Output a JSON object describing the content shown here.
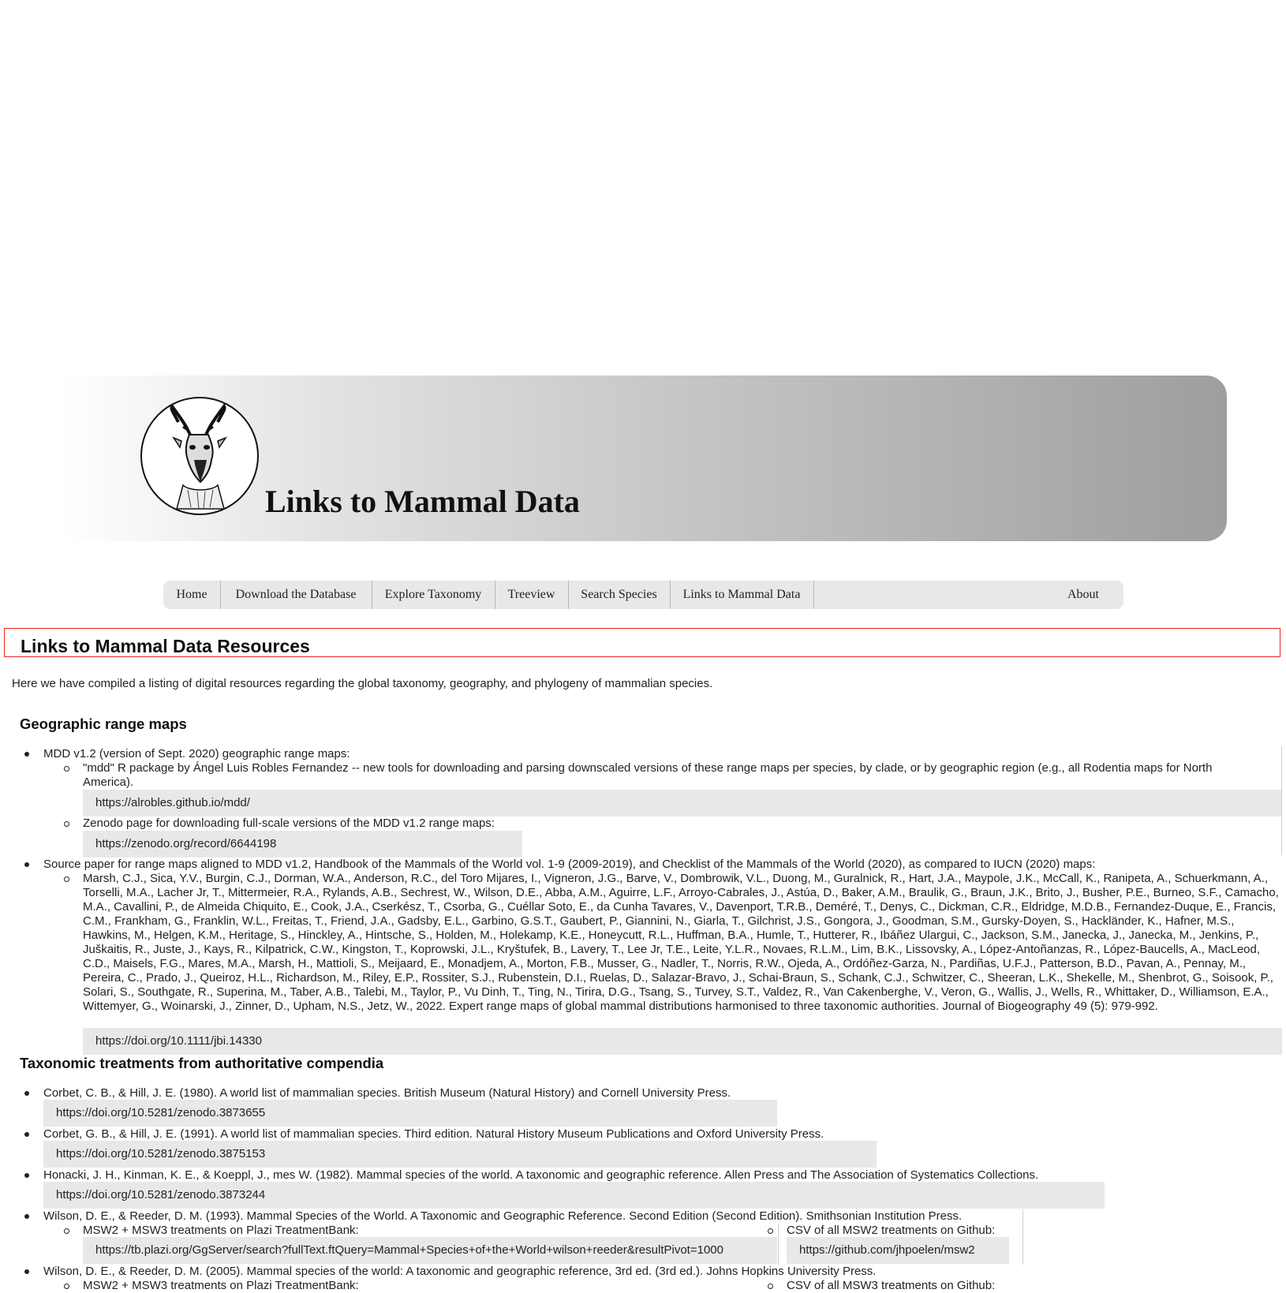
{
  "header": {
    "site_title": "Links to Mammal Data"
  },
  "nav": {
    "items": [
      {
        "label": "Home"
      },
      {
        "label": "Download the Database"
      },
      {
        "label": "Explore Taxonomy"
      },
      {
        "label": "Treeview"
      },
      {
        "label": "Search Species"
      },
      {
        "label": "Links to Mammal Data"
      }
    ],
    "about": "About"
  },
  "page": {
    "title": "Links to Mammal Data Resources",
    "intro": "Here we have compiled a listing of digital resources regarding the global taxonomy, geography, and phylogeny of mammalian species."
  },
  "geographic": {
    "heading": "Geographic range maps",
    "item1": {
      "text": "MDD v1.2 (version of Sept. 2020) geographic range maps:",
      "sub1_text": "\"mdd\" R package by Ángel Luis Robles Fernandez -- new tools for downloading and parsing downscaled versions of these range maps per species, by clade, or by geographic region (e.g., all Rodentia maps for North America).",
      "sub1_link": "https://alrobles.github.io/mdd/",
      "sub2_text": "Zenodo page for downloading full-scale versions of the MDD v1.2 range maps:",
      "sub2_link": "https://zenodo.org/record/6644198"
    },
    "item2": {
      "text": "Source paper for range maps aligned to MDD v1.2, Handbook of the Mammals of the World vol. 1-9 (2009-2019), and Checklist of the Mammals of the World (2020), as compared to IUCN (2020) maps:",
      "citation": "Marsh, C.J., Sica, Y.V., Burgin, C.J., Dorman, W.A., Anderson, R.C., del Toro Mijares, I., Vigneron, J.G., Barve, V., Dombrowik, V.L., Duong, M., Guralnick, R., Hart, J.A., Maypole, J.K., McCall, K., Ranipeta, A., Schuerkmann, A., Torselli, M.A., Lacher Jr, T., Mittermeier, R.A., Rylands, A.B., Sechrest, W., Wilson, D.E., Abba, A.M., Aguirre, L.F., Arroyo-Cabrales, J., Astúa, D., Baker, A.M., Braulik, G., Braun, J.K., Brito, J., Busher, P.E., Burneo, S.F., Camacho, M.A., Cavallini, P., de Almeida Chiquito, E., Cook, J.A., Cserkész, T., Csorba, G., Cuéllar Soto, E., da Cunha Tavares, V., Davenport, T.R.B., Deméré, T., Denys, C., Dickman, C.R., Eldridge, M.D.B., Fernandez-Duque, E., Francis, C.M., Frankham, G., Franklin, W.L., Freitas, T., Friend, J.A., Gadsby, E.L., Garbino, G.S.T., Gaubert, P., Giannini, N., Giarla, T., Gilchrist, J.S., Gongora, J., Goodman, S.M., Gursky-Doyen, S., Hackländer, K., Hafner, M.S., Hawkins, M., Helgen, K.M., Heritage, S., Hinckley, A., Hintsche, S., Holden, M., Holekamp, K.E., Honeycutt, R.L., Huffman, B.A., Humle, T., Hutterer, R., Ibáñez Ulargui, C., Jackson, S.M., Janecka, J., Janecka, M., Jenkins, P., Juškaitis, R., Juste, J., Kays, R., Kilpatrick, C.W., Kingston, T., Koprowski, J.L., Kryštufek, B., Lavery, T., Lee Jr, T.E., Leite, Y.L.R., Novaes, R.L.M., Lim, B.K., Lissovsky, A., López-Antoñanzas, R., López-Baucells, A., MacLeod, C.D., Maisels, F.G., Mares, M.A., Marsh, H., Mattioli, S., Meijaard, E., Monadjem, A., Morton, F.B., Musser, G., Nadler, T., Norris, R.W., Ojeda, A., Ordóñez-Garza, N., Pardiñas, U.F.J., Patterson, B.D., Pavan, A., Pennay, M., Pereira, C., Prado, J., Queiroz, H.L., Richardson, M., Riley, E.P., Rossiter, S.J., Rubenstein, D.I., Ruelas, D., Salazar-Bravo, J., Schai-Braun, S., Schank, C.J., Schwitzer, C., Sheeran, L.K., Shekelle, M., Shenbrot, G., Soisook, P., Solari, S., Southgate, R., Superina, M., Taber, A.B., Talebi, M., Taylor, P., Vu Dinh, T., Ting, N., Tirira, D.G., Tsang, S., Turvey, S.T., Valdez, R., Van Cakenberghe, V., Veron, G., Wallis, J., Wells, R., Whittaker, D., Williamson, E.A., Wittemyer, G., Woinarski, J., Zinner, D., Upham, N.S., Jetz, W., 2022. Expert range maps of global mammal distributions harmonised to three taxonomic authorities. Journal of Biogeography 49 (5): 979-992.",
      "link": "https://doi.org/10.1111/jbi.14330"
    }
  },
  "taxonomic": {
    "heading": "Taxonomic treatments from authoritative compendia",
    "items": [
      {
        "text": "Corbet, C. B., & Hill, J. E. (1980). A world list of mammalian species. British Museum (Natural History) and Cornell University Press.",
        "link": "https://doi.org/10.5281/zenodo.3873655"
      },
      {
        "text": "Corbet, G. B., & Hill, J. E. (1991). A world list of mammalian species. Third edition. Natural History Museum Publications and Oxford University Press.",
        "link": "https://doi.org/10.5281/zenodo.3875153"
      },
      {
        "text": "Honacki, J. H., Kinman, K. E., & Koeppl, J., mes W. (1982). Mammal species of the world. A taxonomic and geographic reference. Allen Press and The Association of Systematics Collections.",
        "link": "https://doi.org/10.5281/zenodo.3873244"
      },
      {
        "text": "Wilson, D. E., & Reeder, D. M. (1993). Mammal Species of the World. A Taxonomic and Geographic Reference. Second Edition (Second Edition). Smithsonian Institution Press.",
        "sub_left_text": "MSW2 + MSW3 treatments on Plazi TreatmentBank:",
        "sub_left_link": "https://tb.plazi.org/GgServer/search?fullText.ftQuery=Mammal+Species+of+the+World+wilson+reeder&resultPivot=1000",
        "sub_right_text": "CSV of all MSW2 treatments on Github:",
        "sub_right_link": "https://github.com/jhpoelen/msw2"
      },
      {
        "text": "Wilson, D. E., & Reeder, D. M. (2005). Mammal species of the world: A taxonomic and geographic reference, 3rd ed. (3rd ed.). Johns Hopkins University Press.",
        "sub_left_text": "MSW2 + MSW3 treatments on Plazi TreatmentBank:",
        "sub_right_text": "CSV of all MSW3 treatments on Github:"
      }
    ]
  }
}
